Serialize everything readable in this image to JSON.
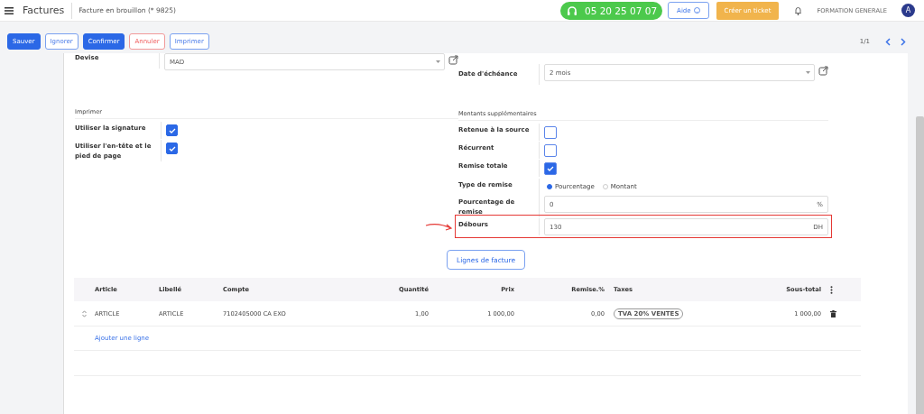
{
  "topbar": {
    "app_title": "Factures",
    "breadcrumb": "Facture en brouillon (* 9825)",
    "phone": "05 20 25 07 07",
    "help_button": "Aide",
    "ticket_button": "Créer un ticket",
    "company": "FORMATION GENERALE",
    "avatar": "A"
  },
  "toolbar": {
    "buttons": [
      {
        "label": "Sauver",
        "kind": "primary"
      },
      {
        "label": "Ignorer",
        "kind": "outline"
      },
      {
        "label": "Confirmer",
        "kind": "primary"
      },
      {
        "label": "Annuler",
        "kind": "danger"
      },
      {
        "label": "Imprimer",
        "kind": "outline"
      }
    ],
    "pager": "1/1"
  },
  "form": {
    "left": [
      {
        "kind": "select",
        "label": "Devise",
        "value": "MAD"
      },
      {
        "kind": "section",
        "title": "Imprimer"
      },
      {
        "kind": "checkbox",
        "label": "Utiliser la signature",
        "checked": true
      },
      {
        "kind": "checkbox",
        "label": "Utiliser l'en-tête et le pied de page",
        "checked": true
      }
    ],
    "right": [
      {
        "kind": "select",
        "label": "Date d'échéance",
        "value": "2 mois"
      },
      {
        "kind": "section",
        "title": "Montants supplémentaires"
      },
      {
        "kind": "checkbox",
        "label": "Retenue à la source",
        "checked": false
      },
      {
        "kind": "checkbox",
        "label": "Récurrent",
        "checked": false
      },
      {
        "kind": "checkbox",
        "label": "Remise totale",
        "checked": true
      },
      {
        "kind": "radio",
        "label": "Type de remise",
        "options": [
          {
            "label": "Pourcentage",
            "selected": true
          },
          {
            "label": "Montant",
            "selected": false
          }
        ]
      },
      {
        "kind": "input",
        "label": "Pourcentage de remise",
        "value": "0",
        "unit": "%",
        "highlighted": false
      },
      {
        "kind": "input",
        "label": "Débours",
        "value": "130",
        "unit": "DH",
        "highlighted": true
      }
    ]
  },
  "lines_button": "Lignes de facture",
  "table": {
    "columns": [
      "Article",
      "Libellé",
      "Compte",
      "Quantité",
      "Prix",
      "Remise.%",
      "Taxes",
      "Sous-total"
    ],
    "rows": [
      {
        "cells": [
          "ARTICLE",
          "ARTICLE",
          "7102405000 CA EXO",
          "1,00",
          "1 000,00",
          "0,00",
          "TVA 20% VENTES",
          "1 000,00"
        ]
      }
    ],
    "add_line": "Ajouter une ligne"
  }
}
